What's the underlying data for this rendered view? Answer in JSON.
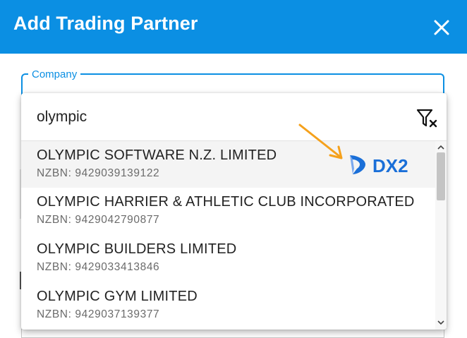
{
  "dialog": {
    "title": "Add Trading Partner",
    "close_icon": "close-icon",
    "header_color": "#0b8fe3"
  },
  "company_field": {
    "label": "Company"
  },
  "search": {
    "value": "olympic",
    "clear_filter_icon": "filter-clear-icon"
  },
  "results": [
    {
      "name": "OLYMPIC SOFTWARE N.Z. LIMITED",
      "nzbn": "NZBN: 9429039139122",
      "highlighted": true
    },
    {
      "name": "OLYMPIC HARRIER & ATHLETIC CLUB INCORPORATED",
      "nzbn": "NZBN: 9429042790877",
      "highlighted": false
    },
    {
      "name": "OLYMPIC BUILDERS LIMITED",
      "nzbn": "NZBN: 9429033413846",
      "highlighted": false
    },
    {
      "name": "OLYMPIC GYM LIMITED",
      "nzbn": "NZBN: 9429037139377",
      "highlighted": false
    }
  ],
  "annotation": {
    "logo_text": "DX2",
    "arrow_color": "#f5a11c",
    "logo_color": "#1a6fd8"
  }
}
